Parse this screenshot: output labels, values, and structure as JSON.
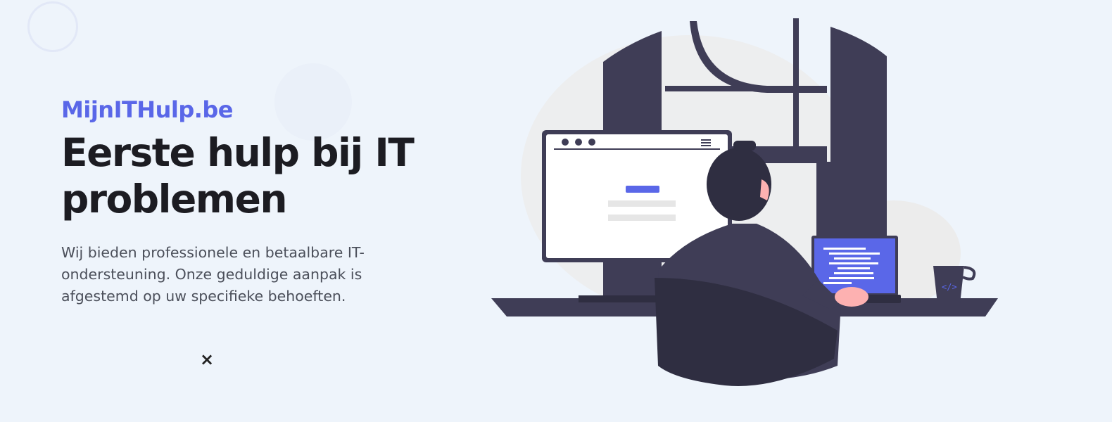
{
  "hero": {
    "brand": "MijnITHulp.be",
    "headline": "Eerste hulp bij IT problemen",
    "lead": "Wij bieden professionele en betaalbare IT-ondersteuning. Onze geduldige aanpak is afgestemd op uw specifieke behoeften.",
    "close_label": "×"
  },
  "colors": {
    "background": "#eef4fb",
    "brand": "#5a67e8",
    "headline": "#1c1c22",
    "body_text": "#4b4f5a",
    "illustration_dark": "#3f3d56",
    "screen": "#5a67e8",
    "skin": "#fdb1b1"
  },
  "icons": [
    "decorative-circle",
    "close-icon",
    "developer-illustration",
    "code-mug-icon"
  ]
}
